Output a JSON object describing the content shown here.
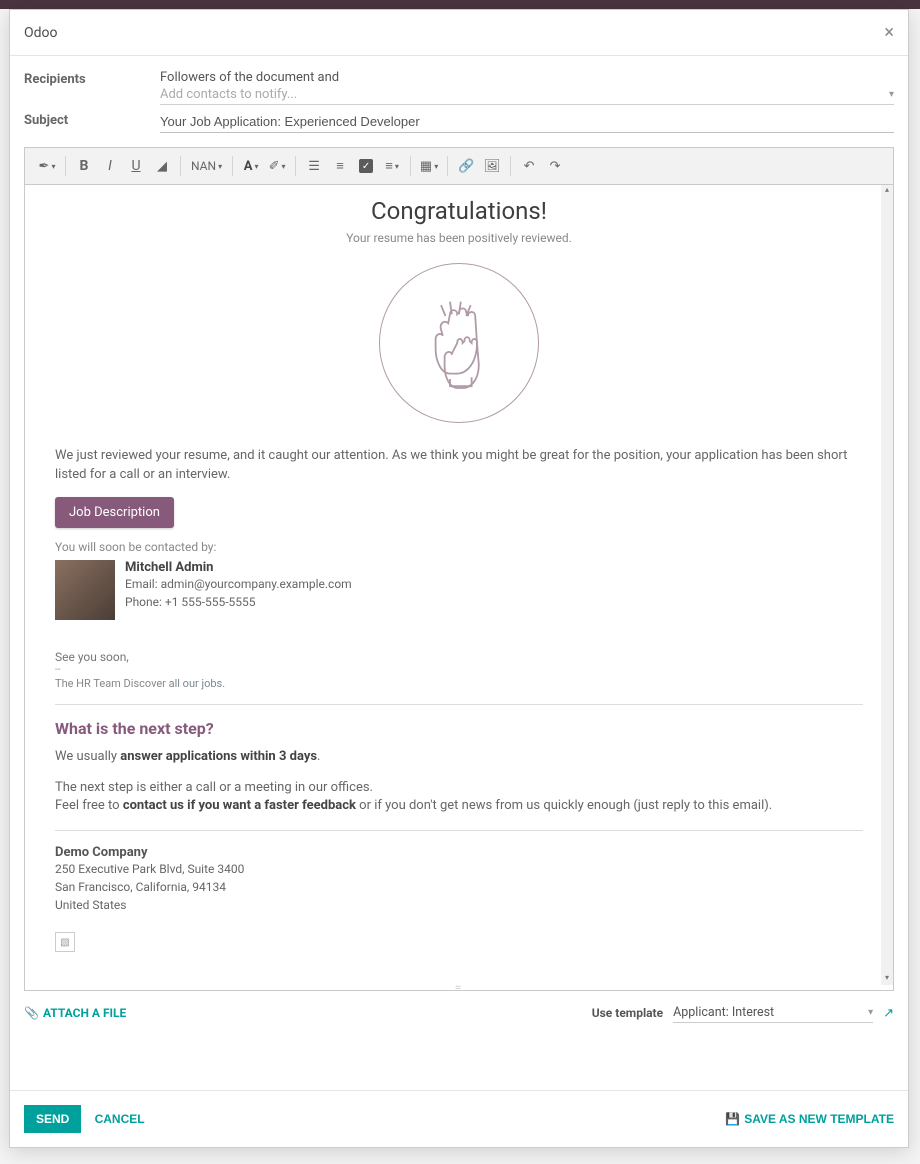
{
  "header": {
    "title": "Odoo"
  },
  "form": {
    "recipients_label": "Recipients",
    "followers_text": "Followers of the document and",
    "add_contacts_placeholder": "Add contacts to notify...",
    "subject_label": "Subject",
    "subject_value": "Your Job Application: Experienced Developer"
  },
  "toolbar": {
    "font_size": "NAN"
  },
  "body": {
    "congrats": "Congratulations!",
    "sub": "Your resume has been positively reviewed.",
    "intro": "We just reviewed your resume, and it caught our attention. As we think you might be great for the position, your application has been short listed for a call or an interview.",
    "job_desc_btn": "Job Description",
    "contacted_by": "You will soon be contacted by:",
    "contact": {
      "name": "Mitchell Admin",
      "email_label": "Email: ",
      "email": "admin@yourcompany.example.com",
      "phone_label": "Phone: ",
      "phone": "+1 555-555-5555"
    },
    "see_you": "See you soon,",
    "dashes": "--",
    "hr_team_pre": "The HR Team Discover ",
    "hr_team_link": "all our jobs",
    "hr_team_suf": ".",
    "next_heading": "What is the next step?",
    "usually_pre": "We usually ",
    "usually_bold": "answer applications within 3 days",
    "usually_suf": ".",
    "step_line1": "The next step is either a call or a meeting in our offices.",
    "feel_pre": "Feel free to ",
    "feel_bold": "contact us if you want a faster feedback",
    "feel_suf": " or if you don't get news from us quickly enough (just reply to this email).",
    "company": "Demo Company",
    "addr1": "250 Executive Park Blvd, Suite 3400",
    "addr2": "San Francisco, California, 94134",
    "addr3": "United States"
  },
  "footer": {
    "attach": "ATTACH A FILE",
    "use_template_lbl": "Use template",
    "template_value": "Applicant: Interest",
    "send": "SEND",
    "cancel": "CANCEL",
    "save_tpl": "SAVE AS NEW TEMPLATE"
  }
}
